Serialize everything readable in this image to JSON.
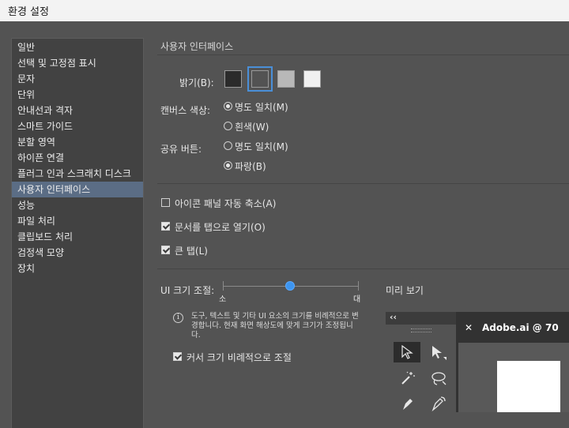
{
  "window": {
    "title": "환경 설정"
  },
  "sidebar": {
    "items": [
      {
        "label": "일반"
      },
      {
        "label": "선택 및 고정점 표시"
      },
      {
        "label": "문자"
      },
      {
        "label": "단위"
      },
      {
        "label": "안내선과 격자"
      },
      {
        "label": "스마트 가이드"
      },
      {
        "label": "분할 영역"
      },
      {
        "label": "하이픈 연결"
      },
      {
        "label": "플러그 인과 스크래치 디스크"
      },
      {
        "label": "사용자 인터페이스",
        "selected": true
      },
      {
        "label": "성능"
      },
      {
        "label": "파일 처리"
      },
      {
        "label": "클립보드 처리"
      },
      {
        "label": "검정색 모양"
      },
      {
        "label": "장치"
      }
    ]
  },
  "main": {
    "section_title": "사용자 인터페이스",
    "brightness": {
      "label": "밝기(B):",
      "swatches": [
        "#2b2b2b",
        "#535353",
        "#b8b8b8",
        "#f0f0f0"
      ],
      "selected_index": 1
    },
    "canvas_color": {
      "label": "캔버스 색상:",
      "options": [
        {
          "label": "명도 일치(M)",
          "selected": true
        },
        {
          "label": "흰색(W)",
          "selected": false
        }
      ]
    },
    "shared_button": {
      "label": "공유 버튼:",
      "options": [
        {
          "label": "명도 일치(M)",
          "selected": false
        },
        {
          "label": "파랑(B)",
          "selected": true
        }
      ]
    },
    "checkboxes": [
      {
        "label": "아이콘 패널 자동 축소(A)",
        "checked": false
      },
      {
        "label": "문서를 탭으로 열기(O)",
        "checked": true
      },
      {
        "label": "큰 탭(L)",
        "checked": true
      }
    ],
    "ui_scale": {
      "label": "UI 크기 조절:",
      "min_label": "소",
      "max_label": "대",
      "value_fraction": 0.5,
      "info_text": "도구, 텍스트 및 기타 UI 요소의 크기를 비례적으로 변경합니다. 현재 화면 해상도에 맞게 크기가 조정됩니다.",
      "cursor_scale_label": "커서 크기 비례적으로 조절",
      "cursor_scale_checked": true
    },
    "preview": {
      "label": "미리 보기",
      "collapse_glyph": "‹‹",
      "tab_close_glyph": "✕",
      "tab_title": "Adobe.ai @ 70"
    }
  }
}
